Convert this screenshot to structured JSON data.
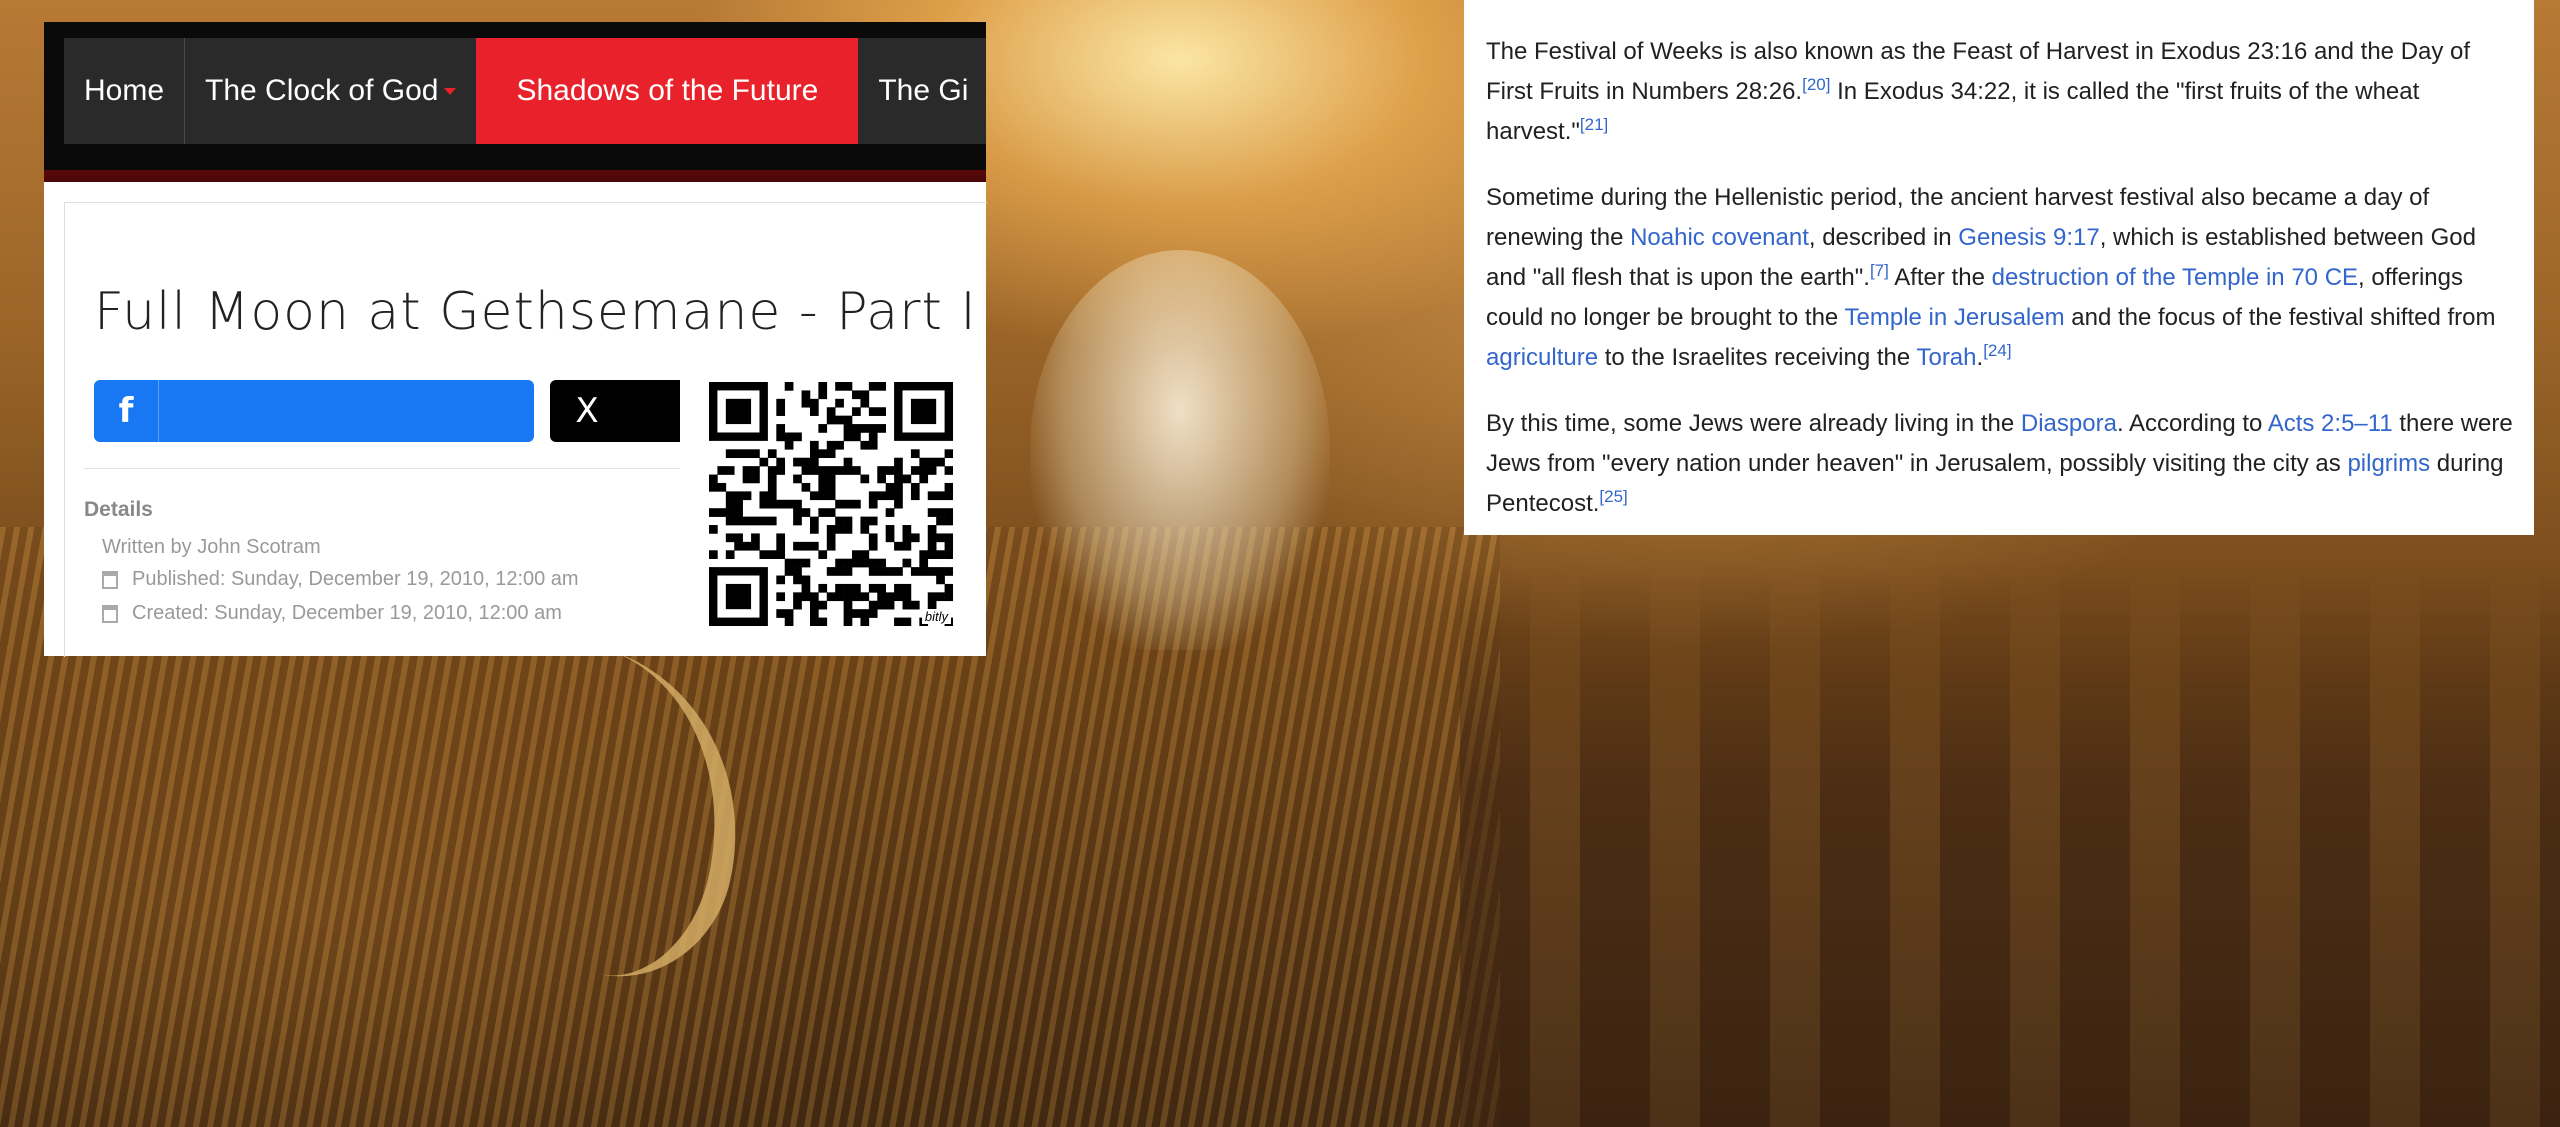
{
  "nav": {
    "items": [
      {
        "label": "Home"
      },
      {
        "label": "The Clock of God",
        "has_dropdown": true
      },
      {
        "label": "Shadows of the Future",
        "active": true
      },
      {
        "label": "The Gi"
      }
    ]
  },
  "article": {
    "title": "Full Moon at Gethsemane - Part I",
    "share": {
      "facebook_icon": "f",
      "x_icon": "X"
    },
    "details_heading": "Details",
    "written_by": "Written by John Scotram",
    "published": "Published: Sunday, December 19, 2010, 12:00 am",
    "created": "Created: Sunday, December 19, 2010, 12:00 am",
    "qr_brand": "bitly"
  },
  "wiki": {
    "p1": {
      "t1": "The Festival of Weeks is also known as the Feast of Harvest in Exodus 23:16 and the Day of First Fruits in Numbers 28:26.",
      "ref1": "[20]",
      "t2": " In Exodus 34:22, it is called the \"first fruits of the wheat harvest.\"",
      "ref2": "[21]"
    },
    "p2": {
      "t1": "Sometime during the Hellenistic period, the ancient harvest festival also became a day of renewing the ",
      "link1": "Noahic covenant",
      "t2": ", described in ",
      "link2": "Genesis 9:17",
      "t3": ", which is established between God and \"all flesh that is upon the earth\".",
      "ref1": "[7]",
      "t4": " After the ",
      "link3": "destruction of the Temple in 70 CE",
      "t5": ", offerings could no longer be brought to the ",
      "link4": "Temple in Jerusalem",
      "t6": " and the focus of the festival shifted from ",
      "link5": "agriculture",
      "t7": " to the Israelites receiving the ",
      "link6": "Torah",
      "t8": ".",
      "ref2": "[24]"
    },
    "p3": {
      "t1": "By this time, some Jews were already living in the ",
      "link1": "Diaspora",
      "t2": ". According to ",
      "link2": "Acts 2:5–11",
      "t3": " there were Jews from \"every nation under heaven\" in Jerusalem, possibly visiting the city as ",
      "link3": "pilgrims",
      "t4": " during Pentecost.",
      "ref1": "[25]"
    }
  },
  "colors": {
    "nav_active": "#e8212a",
    "facebook": "#1877f2",
    "link": "#3366cc"
  }
}
